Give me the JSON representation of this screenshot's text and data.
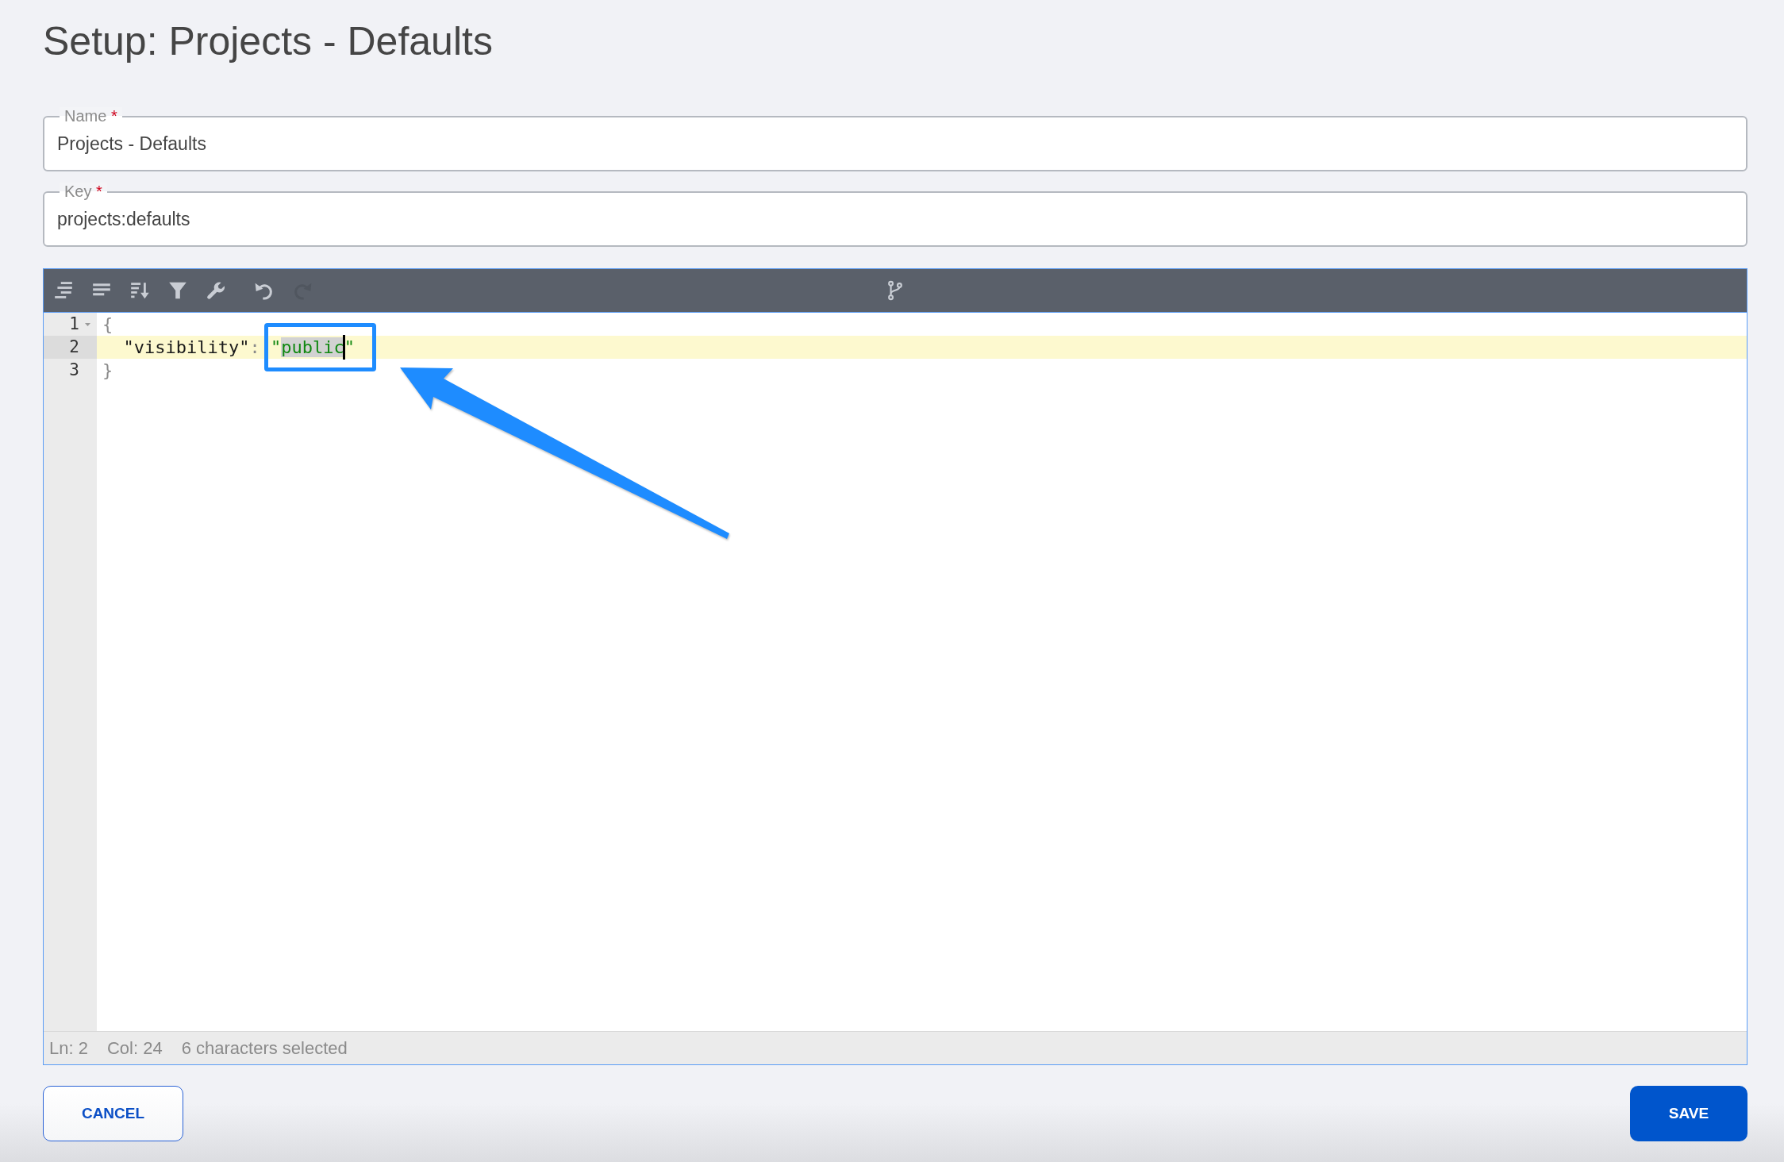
{
  "title": "Setup: Projects - Defaults",
  "fields": [
    {
      "label": "Name",
      "required_mark": "*",
      "value": "Projects - Defaults"
    },
    {
      "label": "Key",
      "required_mark": "*",
      "value": "projects:defaults"
    }
  ],
  "editor": {
    "toolbar": {
      "buttons": [
        {
          "disabled": false
        },
        {
          "disabled": false
        },
        {
          "disabled": false
        },
        {
          "disabled": false
        },
        {
          "disabled": false
        },
        {
          "disabled": false
        },
        {
          "disabled": true
        }
      ],
      "center_buttons": [
        {
          "disabled": false
        }
      ]
    },
    "lines": [
      {
        "number": "1",
        "foldable": true,
        "active": false,
        "tokens": [
          {
            "kind": "brace",
            "text": "{",
            "framed": false
          }
        ],
        "children": [
          {
            "number": "2",
            "foldable": false,
            "active": true,
            "tokens": [
              {
                "kind": "key",
                "text": "\"visibility\"",
                "framed": false
              },
              {
                "kind": "colon",
                "text": ":",
                "framed": false
              },
              {
                "kind": "string",
                "framed": true,
                "parts": [
                  {
                    "text": "\"",
                    "selected": false,
                    "caret": false
                  },
                  {
                    "text": "public",
                    "selected": true,
                    "caret": true
                  },
                  {
                    "text": "\"",
                    "selected": false,
                    "caret": false
                  }
                ]
              }
            ]
          }
        ]
      },
      {
        "number": "3",
        "foldable": false,
        "active": false,
        "tokens": [
          {
            "kind": "brace",
            "text": "}",
            "framed": false
          }
        ]
      }
    ],
    "status_bar": [
      "Ln: 2",
      "Col: 24",
      "6 characters selected"
    ]
  },
  "buttons": [
    {
      "label": "CANCEL",
      "kind": "secondary"
    },
    {
      "label": "SAVE",
      "kind": "primary"
    }
  ]
}
